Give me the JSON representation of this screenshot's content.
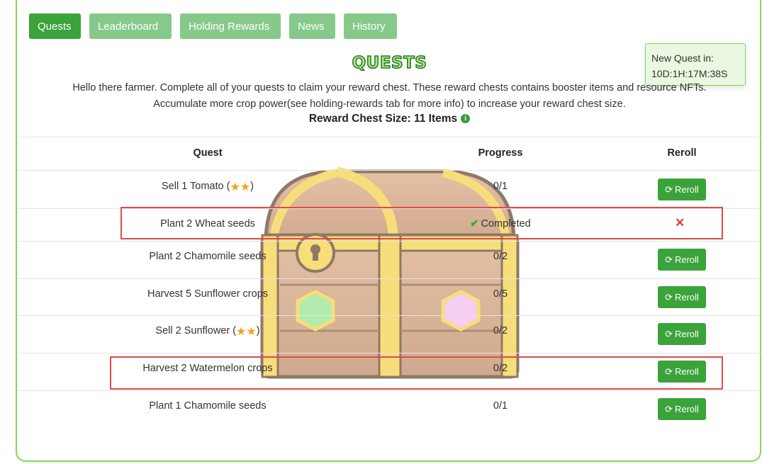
{
  "tabs": [
    {
      "label": "Quests",
      "active": true
    },
    {
      "label": "Leaderboard",
      "active": false
    },
    {
      "label": "Holding Rewards",
      "active": false
    },
    {
      "label": "News",
      "active": false
    },
    {
      "label": "History",
      "active": false
    }
  ],
  "timer": {
    "label": "New Quest in:",
    "value": "10D:1H:17M:38S"
  },
  "title": "QUESTS",
  "intro": {
    "line1": "Hello there farmer. Complete all of your quests to claim your reward chest. These reward chests contains booster items and resource NFTs.",
    "line2": "Accumulate more crop power(see holding-rewards tab for more info) to increase your reward chest size."
  },
  "chest_size": {
    "label": "Reward Chest Size: 11 Items"
  },
  "table": {
    "headers": {
      "quest": "Quest",
      "progress": "Progress",
      "reroll": "Reroll"
    },
    "reroll_label": "Reroll",
    "rows": [
      {
        "quest": "Sell 1 Tomato (",
        "quest_suffix": ")",
        "stars": 2,
        "progress": "0/1",
        "reroll": true
      },
      {
        "quest": "Plant 2 Wheat seeds",
        "progress": "Completed",
        "reroll": false
      },
      {
        "quest": "Plant 2 Chamomile seeds",
        "progress": "0/2",
        "reroll": true
      },
      {
        "quest": "Harvest 5 Sunflower crops",
        "progress": "0/5",
        "reroll": true
      },
      {
        "quest": "Sell 2 Sunflower (",
        "quest_suffix": ")",
        "stars": 2,
        "progress": "0/2",
        "reroll": true
      },
      {
        "quest": "Harvest 2 Watermelon crops",
        "progress": "0/2",
        "reroll": true
      },
      {
        "quest": "Plant 1 Chamomile seeds",
        "progress": "0/1",
        "reroll": true
      }
    ]
  },
  "colors": {
    "brand_green": "#3aa33a",
    "border_green": "#7ed957",
    "highlight_red": "#e24a4a",
    "star": "#f4a21a"
  },
  "icons": {
    "reroll": "refresh-icon",
    "completed": "checkmark-icon",
    "not_rerollable": "x-icon",
    "info": "info-icon",
    "star": "star-icon"
  }
}
